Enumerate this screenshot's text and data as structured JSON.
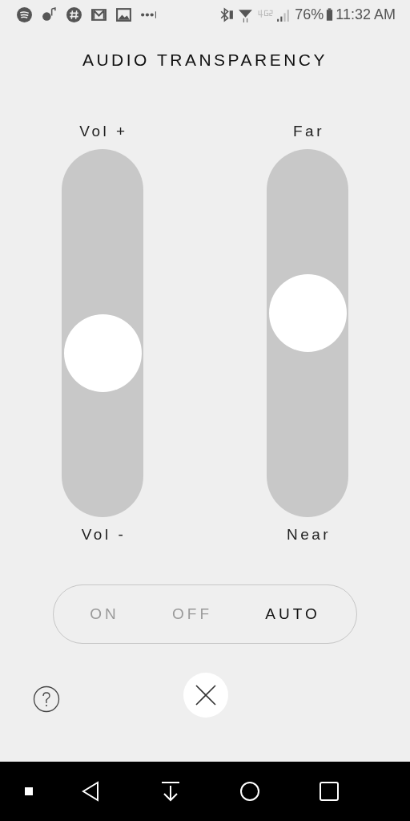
{
  "status_bar": {
    "battery": "76%",
    "time": "11:32 AM"
  },
  "dialog": {
    "title": "AUDIO TRANSPARENCY",
    "sliders": [
      {
        "top_label": "Vol +",
        "bottom_label": "Vol -",
        "level": 0.43
      },
      {
        "top_label": "Far",
        "bottom_label": "Near",
        "level": 0.57
      }
    ],
    "modes": [
      {
        "label": "ON",
        "selected": false
      },
      {
        "label": "OFF",
        "selected": false
      },
      {
        "label": "AUTO",
        "selected": true
      }
    ]
  }
}
